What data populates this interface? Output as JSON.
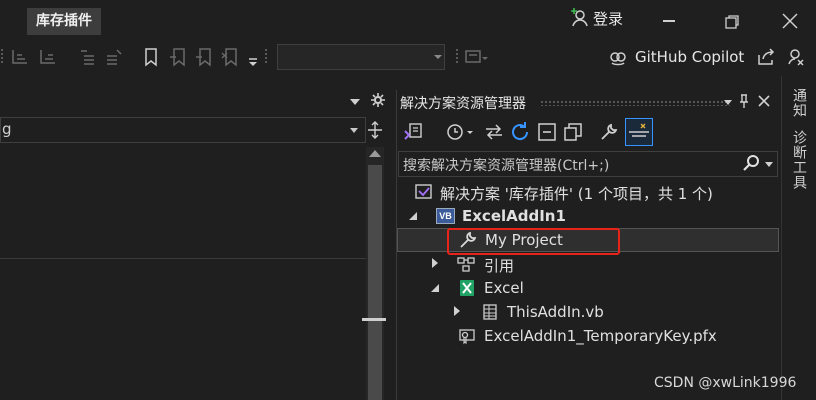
{
  "titlebar": {
    "project_tab": "库存插件",
    "login_label": "登录"
  },
  "toolbar": {
    "copilot_label": "GitHub Copilot"
  },
  "editor": {
    "combo_text": "g"
  },
  "solution_explorer": {
    "title": "解决方案资源管理器",
    "search_placeholder": "搜索解决方案资源管理器(Ctrl+;)",
    "tree": {
      "solution": "解决方案 '库存插件' (1 个项目，共 1 个)",
      "project": "ExcelAddIn1",
      "my_project": "My Project",
      "references": "引用",
      "excel": "Excel",
      "thisaddin": "ThisAddIn.vb",
      "tempkey": "ExcelAddIn1_TemporaryKey.pfx"
    },
    "project_badge": "VB"
  },
  "side_tabs": {
    "notifications": "通知",
    "diagnostics": "诊断工具"
  },
  "watermark": "CSDN @xwLink1996",
  "colors": {
    "background": "#1f1f1f",
    "highlight_box": "#e8231a",
    "accent_blue": "#3794ff",
    "excel_green": "#21a366"
  }
}
